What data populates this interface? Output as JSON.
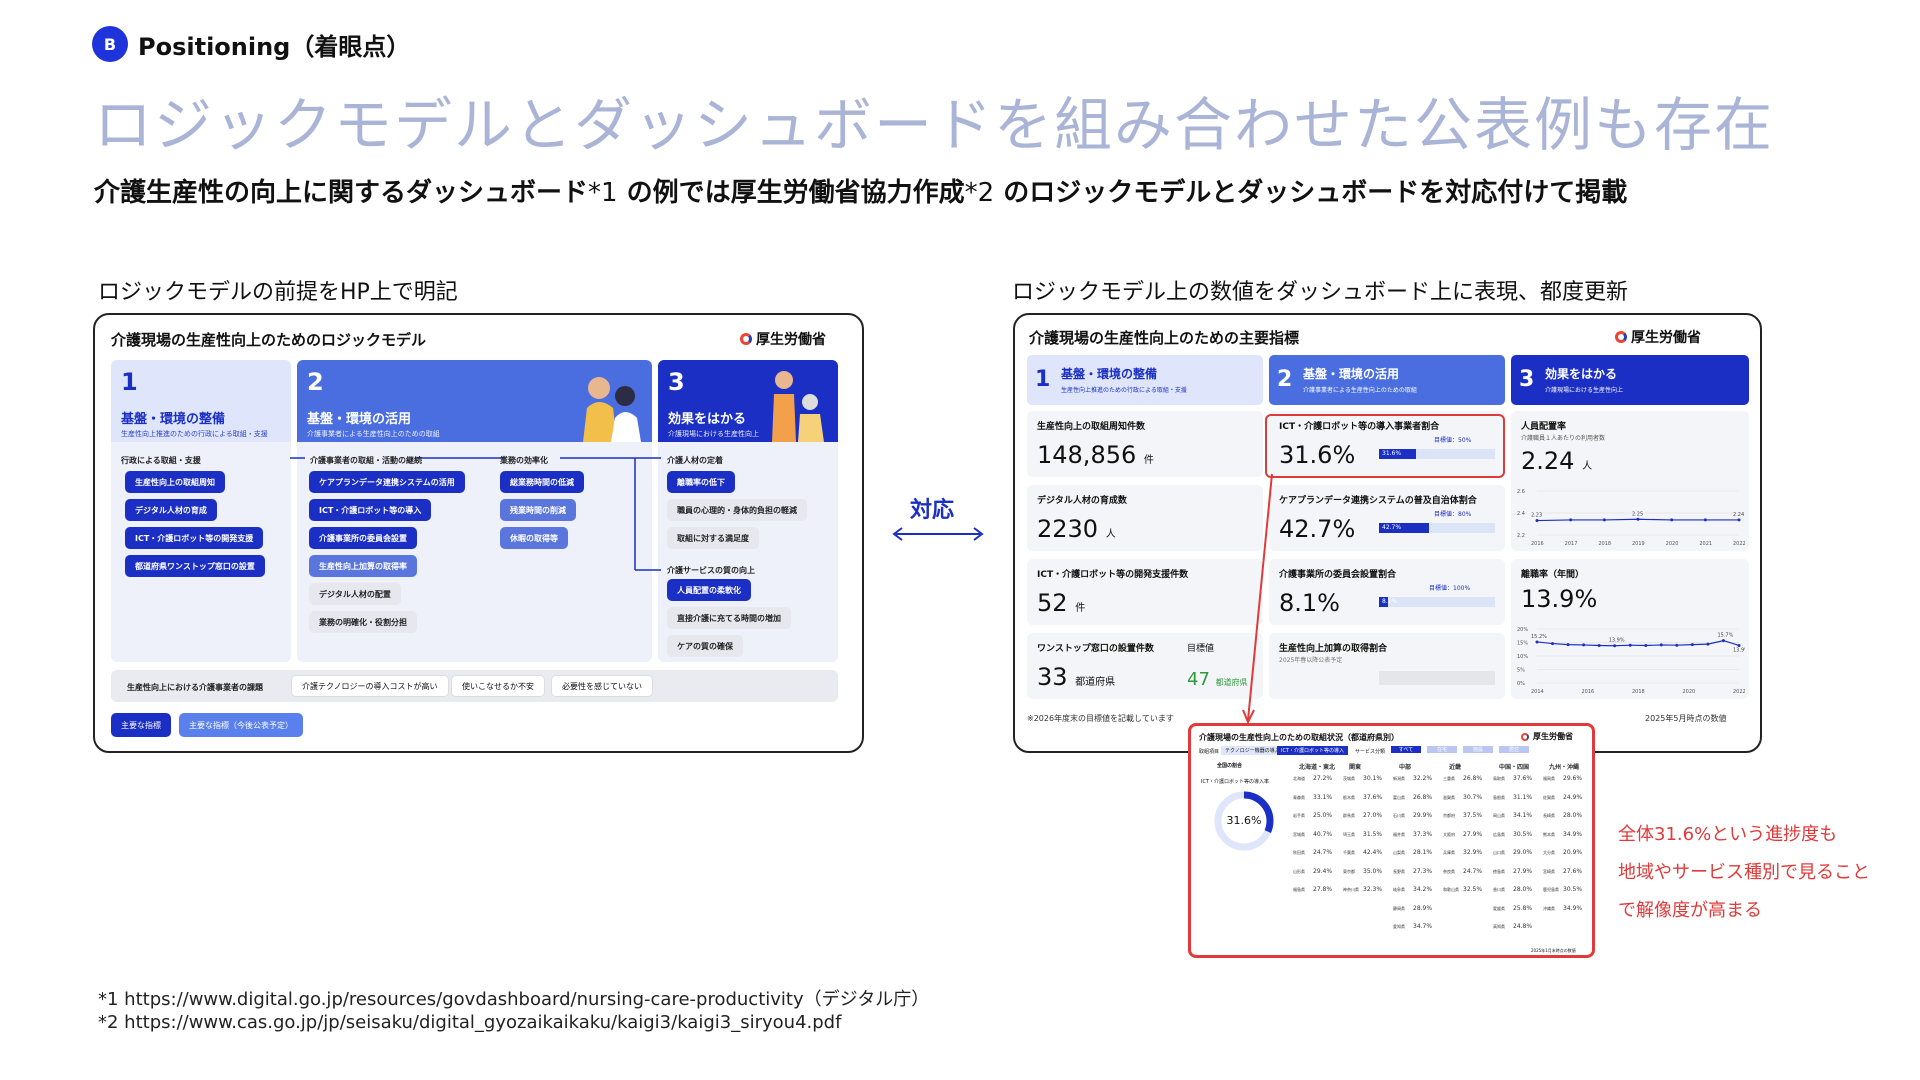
{
  "header": {
    "tag_letter": "B",
    "tag_label": "Positioning（着眼点）",
    "title": "ロジックモデルとダッシュボードを組み合わせた公表例も存在",
    "subtitle_part1": "介護生産性の向上に関するダッシュボード",
    "subtitle_note1": "*1",
    "subtitle_part2": " の例では厚生労働省協力作成",
    "subtitle_note2": "*2",
    "subtitle_part3": " のロジックモデルとダッシュボードを対応付けて掲載"
  },
  "left": {
    "caption": "ロジックモデルの前提をHP上で明記",
    "frame_title": "介護現場の生産性向上のためのロジックモデル",
    "logo": "厚生労働省",
    "columns": [
      {
        "num": "1",
        "heading": "基盤・環境の整備",
        "sub": "生産性向上推進のための行政による取組・支援"
      },
      {
        "num": "2",
        "heading": "基盤・環境の活用",
        "sub": "介護事業者による生産性向上のための取組"
      },
      {
        "num": "3",
        "heading": "効果をはかる",
        "sub": "介護現場における生産性向上"
      }
    ],
    "col1_label": "行政による取組・支援",
    "col1_items": [
      "生産性向上の取組周知",
      "デジタル人材の育成",
      "ICT・介護ロボット等の開発支援",
      "都道府県ワンストップ窓口の設置"
    ],
    "col2_label_a": "介護事業者の取組・活動の継続",
    "col2_items_a": [
      "ケアプランデータ連携システムの活用",
      "ICT・介護ロボット等の導入",
      "介護事業所の委員会設置",
      "生産性向上加算の取得率",
      "デジタル人材の配置",
      "業務の明確化・役割分担"
    ],
    "col2_label_b": "業務の効率化",
    "col2_items_b": [
      "総業務時間の低減",
      "残業時間の削減",
      "休暇の取得等"
    ],
    "col3_label_a": "介護人材の定着",
    "col3_items_a": [
      "離職率の低下",
      "職員の心理的・身体的負担の軽減",
      "取組に対する満足度"
    ],
    "col3_label_b": "介護サービスの質の向上",
    "col3_items_b": [
      "人員配置の柔軟化",
      "直接介護に充てる時間の増加",
      "ケアの質の確保"
    ],
    "challenge_label": "生産性向上における介護事業者の課題",
    "challenges": [
      "介護テクノロジーの導入コストが高い",
      "使いこなせるか不安",
      "必要性を感じていない"
    ],
    "buttons": [
      "主要な指標",
      "主要な指標（今後公表予定）"
    ]
  },
  "mid": {
    "label": "対応"
  },
  "right": {
    "caption": "ロジックモデル上の数値をダッシュボード上に表現、都度更新",
    "frame_title": "介護現場の生産性向上のための主要指標",
    "logo": "厚生労働省",
    "columns": [
      {
        "num": "1",
        "heading": "基盤・環境の整備",
        "sub": "生産性向上推進のための行政による取組・支援"
      },
      {
        "num": "2",
        "heading": "基盤・環境の活用",
        "sub": "介護事業者による生産性向上のための取組"
      },
      {
        "num": "3",
        "heading": "効果をはかる",
        "sub": "介護現場における生産性向上"
      }
    ],
    "col1": [
      {
        "label": "生産性向上の取組周知件数",
        "value": "148,856",
        "unit": "件"
      },
      {
        "label": "デジタル人材の育成数",
        "value": "2230",
        "unit": "人"
      },
      {
        "label": "ICT・介護ロボット等の開発支援件数",
        "value": "52",
        "unit": "件"
      },
      {
        "label": "ワンストップ窓口の設置件数",
        "value": "33",
        "unit": "都道府県",
        "target_label": "目標値",
        "target_value": "47",
        "target_unit": "都道府県"
      }
    ],
    "col2": [
      {
        "label": "ICT・介護ロボット等の導入事業者割合",
        "value": "31.6%",
        "bar": 0.316,
        "target": "目標値：50%"
      },
      {
        "label": "ケアプランデータ連携システムの普及自治体割合",
        "value": "42.7%",
        "bar": 0.427,
        "target": "目標値：80%"
      },
      {
        "label": "介護事業所の委員会設置割合",
        "value": "8.1%",
        "bar": 0.081,
        "target": "目標値：100%"
      },
      {
        "label": "生産性向上加算の取得割合",
        "value": "",
        "note": "2025年春以降公表予定"
      }
    ],
    "col3": [
      {
        "label": "人員配置率",
        "sub": "介護職員１人あたりの利用者数",
        "value": "2.24",
        "unit": "人",
        "series": [
          2.23,
          2.24,
          2.24,
          2.25,
          2.24,
          2.24,
          2.24
        ],
        "point_labels": [
          "2.23",
          "2.25",
          "2.24"
        ],
        "ticks": [
          "2016",
          "2017",
          "2018",
          "2019",
          "2020",
          "2021",
          "2022"
        ],
        "yticks": [
          "2.6",
          "2.4",
          "2.2"
        ]
      },
      {
        "label": "離職率（年間）",
        "value": "13.9%",
        "series": [
          15.2,
          14.6,
          14.2,
          14.1,
          13.9,
          13.8,
          14.0,
          13.9,
          14.1,
          14.0,
          14.2,
          14.4,
          15.7,
          13.9
        ],
        "point_labels": [
          "15.2%",
          "13.9%",
          "15.7%",
          "13.9%"
        ],
        "ticks": [
          "2014",
          "2016",
          "2018",
          "2020",
          "2022"
        ],
        "yticks": [
          "20%",
          "15%",
          "10%",
          "5%",
          "0%"
        ]
      }
    ],
    "footnote": "※2026年度末の目標値を記載しています",
    "date": "2025年5月時点の数値",
    "breakdown": {
      "title": "介護現場の生産性向上のための取組状況（都道府県別）",
      "logo": "厚生労働省",
      "filter_label1": "取組項目",
      "filter_a": "テクノロジー機器の導入",
      "filter_b": "ICT・介護ロボット等の導入",
      "filter_label2": "サービス分類",
      "filter_opts": [
        "すべて",
        "在宅",
        "施設",
        "居住"
      ],
      "national_label": "全国の割合",
      "national_sub": "ICT・介護ロボット等の導入率",
      "donut_value": "31.6%",
      "donut_fraction": 0.316,
      "regions": [
        {
          "name": "北海道・東北",
          "rows": [
            [
              "北海道",
              "27.2%"
            ],
            [
              "青森県",
              "33.1%"
            ],
            [
              "岩手県",
              "25.0%"
            ],
            [
              "宮城県",
              "40.7%"
            ],
            [
              "秋田県",
              "24.7%"
            ],
            [
              "山形県",
              "29.4%"
            ],
            [
              "福島県",
              "27.8%"
            ]
          ]
        },
        {
          "name": "関東",
          "rows": [
            [
              "茨城県",
              "30.1%"
            ],
            [
              "栃木県",
              "37.6%"
            ],
            [
              "群馬県",
              "27.0%"
            ],
            [
              "埼玉県",
              "31.5%"
            ],
            [
              "千葉県",
              "42.4%"
            ],
            [
              "東京都",
              "35.0%"
            ],
            [
              "神奈川県",
              "32.3%"
            ]
          ]
        },
        {
          "name": "中部",
          "rows": [
            [
              "新潟県",
              "32.2%"
            ],
            [
              "富山県",
              "26.8%"
            ],
            [
              "石川県",
              "29.9%"
            ],
            [
              "福井県",
              "37.3%"
            ],
            [
              "山梨県",
              "28.1%"
            ],
            [
              "長野県",
              "27.3%"
            ],
            [
              "岐阜県",
              "34.2%"
            ],
            [
              "静岡県",
              "28.9%"
            ],
            [
              "愛知県",
              "34.7%"
            ]
          ]
        },
        {
          "name": "近畿",
          "rows": [
            [
              "三重県",
              "26.8%"
            ],
            [
              "滋賀県",
              "30.7%"
            ],
            [
              "京都府",
              "37.5%"
            ],
            [
              "大阪府",
              "27.9%"
            ],
            [
              "兵庫県",
              "32.9%"
            ],
            [
              "奈良県",
              "24.7%"
            ],
            [
              "和歌山県",
              "32.5%"
            ]
          ]
        },
        {
          "name": "中国・四国",
          "rows": [
            [
              "鳥取県",
              "37.6%"
            ],
            [
              "島根県",
              "31.1%"
            ],
            [
              "岡山県",
              "34.1%"
            ],
            [
              "広島県",
              "30.5%"
            ],
            [
              "山口県",
              "29.0%"
            ],
            [
              "徳島県",
              "27.9%"
            ],
            [
              "香川県",
              "28.0%"
            ],
            [
              "愛媛県",
              "25.8%"
            ],
            [
              "高知県",
              "24.8%"
            ]
          ]
        },
        {
          "name": "九州・沖縄",
          "rows": [
            [
              "福岡県",
              "29.6%"
            ],
            [
              "佐賀県",
              "24.9%"
            ],
            [
              "長崎県",
              "28.0%"
            ],
            [
              "熊本県",
              "34.9%"
            ],
            [
              "大分県",
              "20.9%"
            ],
            [
              "宮崎県",
              "27.6%"
            ],
            [
              "鹿児島県",
              "30.5%"
            ],
            [
              "沖縄県",
              "34.9%"
            ]
          ]
        }
      ],
      "date": "2025年1月末時点の数値"
    }
  },
  "annotation": [
    "全体31.6%という進捗度も",
    "地域やサービス種別で見ること",
    "で解像度が高まる"
  ],
  "footnotes": [
    "*1 https://www.digital.go.jp/resources/govdashboard/nursing-care-productivity（デジタル庁）",
    "*2 https://www.cas.go.jp/jp/seisaku/digital_gyozaikaikaku/kaigi3/kaigi3_siryou4.pdf"
  ],
  "colors": {
    "accent": "#1b2fc4",
    "title": "#aab4d6",
    "red": "#e03a3a"
  }
}
